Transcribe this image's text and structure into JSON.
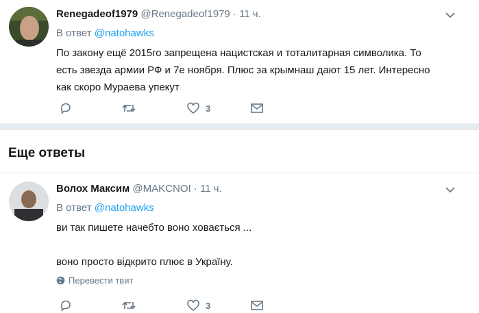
{
  "tweets": [
    {
      "name": "Renegadeof1979",
      "handle": "@Renegadeof1979",
      "time": "· 11 ч.",
      "reply_prefix": "В ответ",
      "reply_to": "@natohawks",
      "lines": [
        "По закону ещё 2015го запрещена нацистская и  тоталитарная символика. То",
        "есть звезда армии РФ и 7е ноября. Плюс за крымнаш дают 15 лет. Интересно",
        "как скоро Мураева упекут"
      ],
      "likes": "3"
    },
    {
      "name": "Волох Максим",
      "handle": "@MAKCNOI",
      "time": "· 11 ч.",
      "reply_prefix": "В ответ",
      "reply_to": "@natohawks",
      "lines": [
        "ви так пишете начебто воно ховається ...",
        "",
        "воно просто відкрито  плює в Україну."
      ],
      "translate": "Перевести твит",
      "likes": "3"
    }
  ],
  "section_title": "Еще ответы",
  "colors": {
    "link": "#1da1f2",
    "secondary": "#657786",
    "separator": "#e6ecf0"
  },
  "icons": [
    "reply-icon",
    "retweet-icon",
    "like-icon",
    "message-icon",
    "chevron-down-icon",
    "globe-icon"
  ]
}
